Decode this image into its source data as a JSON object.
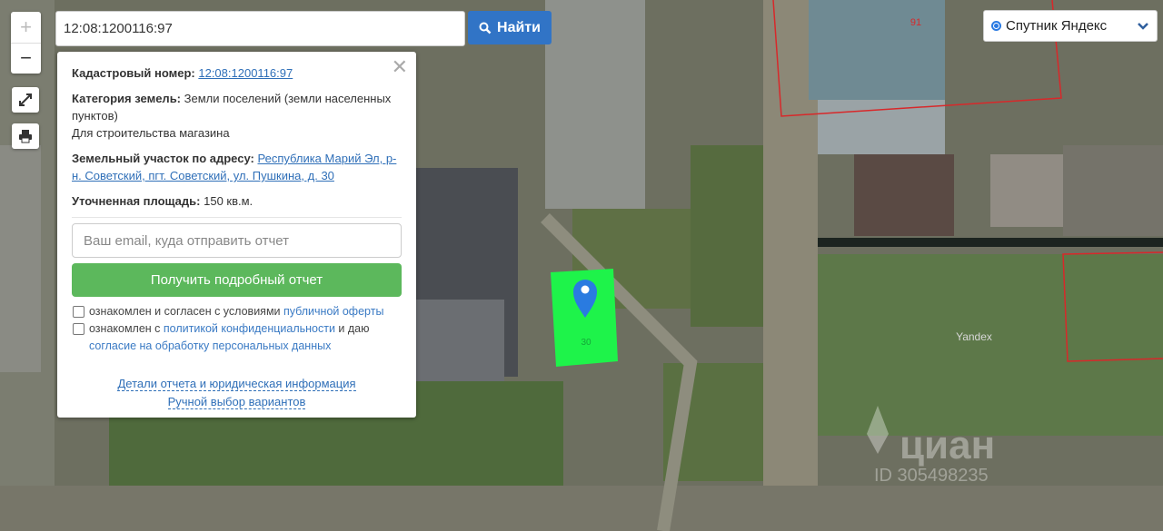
{
  "colors": {
    "accent": "#3174c6",
    "success": "#5cb85c",
    "parcel": "#1ef34a",
    "link": "#2f6fb8"
  },
  "map": {
    "watermark_yandex": "Yandex",
    "watermark_cian": "циан",
    "watermark_id": "ID 305498235",
    "parcel_label": "30",
    "house_number": "91"
  },
  "controls": {
    "zoom_in": "+",
    "zoom_out": "−",
    "fullscreen_icon": "expand-icon",
    "print_icon": "printer-icon"
  },
  "search": {
    "value": "12:08:1200116:97",
    "button_label": "Найти",
    "button_icon": "search-icon"
  },
  "layer": {
    "label": "Спутник Яндекс"
  },
  "popup": {
    "cadastral_label": "Кадастровый номер:",
    "cadastral_value": "12:08:1200116:97",
    "category_label": "Категория земель:",
    "category_value": "Земли поселений (земли населенных пунктов)",
    "usage": "Для строительства магазина",
    "address_label": "Земельный участок по адресу:",
    "address_value": "Республика Марий Эл, р-н. Советский, пгт. Советский, ул. Пушкина, д. 30",
    "area_label": "Уточненная площадь:",
    "area_value": "150 кв.м.",
    "email_placeholder": "Ваш email, куда отправить отчет",
    "submit_label": "Получить подробный отчет",
    "check1_text": "ознакомлен и согласен с условиями ",
    "check1_link": "публичной оферты",
    "check2_text": "ознакомлен с ",
    "check2_link": "политикой конфиденциальности",
    "check2_text2": " и даю ",
    "check2_link2": "согласие на обработку персональных данных",
    "details_link": "Детали отчета и юридическая информация",
    "manual_link": "Ручной выбор вариантов"
  }
}
